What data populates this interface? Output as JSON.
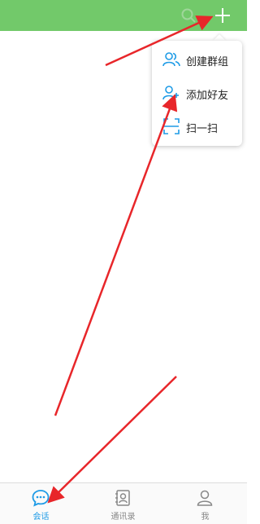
{
  "header": {
    "search_icon": "search-icon",
    "add_icon": "plus-icon",
    "background_color": "#72c96a"
  },
  "menu": {
    "items": [
      {
        "label": "创建群组",
        "icon": "group-icon"
      },
      {
        "label": "添加好友",
        "icon": "add-friend-icon"
      },
      {
        "label": "扫一扫",
        "icon": "scan-icon"
      }
    ],
    "icon_color": "#1e9be6"
  },
  "tabs": [
    {
      "label": "会话",
      "icon": "chat-bubble-icon",
      "active": true
    },
    {
      "label": "通讯录",
      "icon": "contacts-icon",
      "active": false
    },
    {
      "label": "我",
      "icon": "person-icon",
      "active": false
    }
  ],
  "colors": {
    "accent": "#1e9be6",
    "inactive": "#888888",
    "annotation_arrow": "#e8262a"
  }
}
